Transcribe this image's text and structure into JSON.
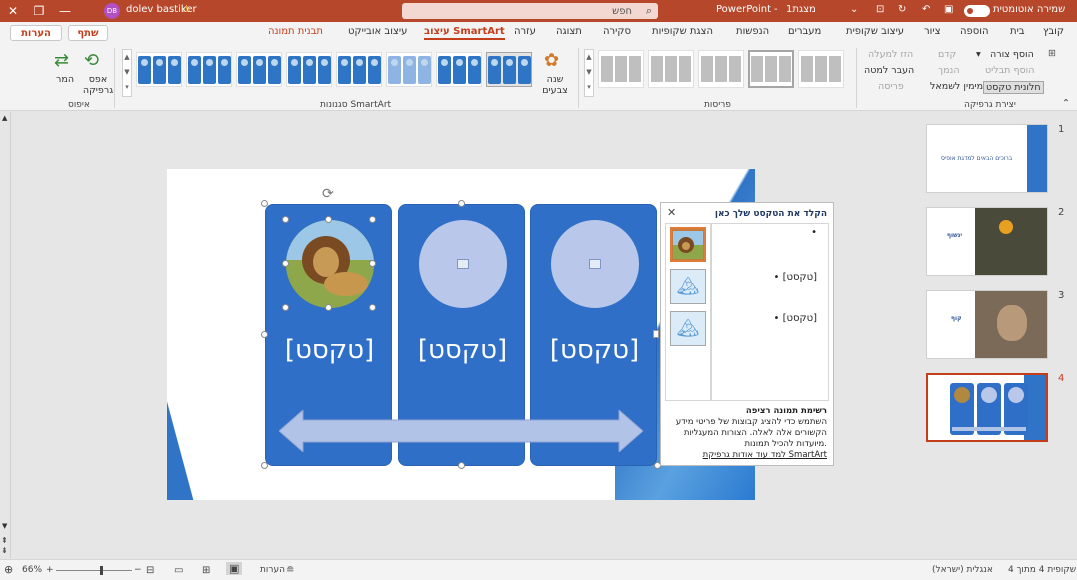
{
  "window": {
    "autosave_label": "שמירה אוטומטית",
    "file_name": "מצגת1",
    "app_name": "PowerPoint",
    "app_separator": "-",
    "search_placeholder": "חפש",
    "user_name": "dolev bastiker",
    "user_initials": "DB",
    "warning_icon": "warning-icon",
    "accent_color": "#b7472a"
  },
  "tabs": [
    "קובץ",
    "בית",
    "הוספה",
    "ציור",
    "עיצוב שקופית",
    "מעברים",
    "הנפשות",
    "הצגת שקופיות",
    "סקירה",
    "תצוגה",
    "עזרה",
    "עיצוב SmartArt",
    "עיצוב אובייקט",
    "תבנית תמונה"
  ],
  "active_tab": "עיצוב SmartArt",
  "share_label": "שתף",
  "comments_label": "הערות",
  "ribbon": {
    "create": {
      "label": "יצירת גרפיקה",
      "add_shape": "הוסף צורה",
      "add_bullet": "הוסף תבליט",
      "text_pane": "חלונית טקסט",
      "promote": "קדם",
      "demote": "הנמך",
      "move_up": "הזז למעלה",
      "move_down": "העבר למטה",
      "rtl": "מימין לשמאל",
      "layout": "פריסה"
    },
    "layouts_label": "פריסות",
    "styles_label": "סגנונות SmartArt",
    "change_colors": "שנה צבעים",
    "reset": {
      "label": "איפוס",
      "reset_graphic": "אפס גרפיקה",
      "convert": "המר"
    }
  },
  "smartart": {
    "panel_texts": [
      "[טקסט]",
      "[טקסט]",
      "[טקסט]"
    ],
    "panel_color": "#2f6fc7"
  },
  "text_pane": {
    "title": "הקלד את הטקסט שלך כאן",
    "bullets": [
      "",
      "[טקסט]",
      "[טקסט]"
    ],
    "footer_heading": "רשימת תמונה רציפה",
    "footer_body": "השתמש כדי להציג קבוצות של פריטי מידע הקשורים אלה לאלה. הצורות המעגליות מיועדות להכיל תמונות.",
    "footer_link": "למד עוד אודות גרפיקת SmartArt"
  },
  "slides": {
    "numbers": [
      "1",
      "2",
      "3",
      "4"
    ],
    "thumb1_title": "ברוכים הבאים למדגת אופיס",
    "thumb2_title": "ינשוף",
    "thumb3_title": "קוף",
    "active": 4
  },
  "status": {
    "slide_info": "שקופית 4 מתוך 4",
    "language": "אנגלית (ישראל)",
    "notes": "הערות",
    "zoom": "66%"
  }
}
